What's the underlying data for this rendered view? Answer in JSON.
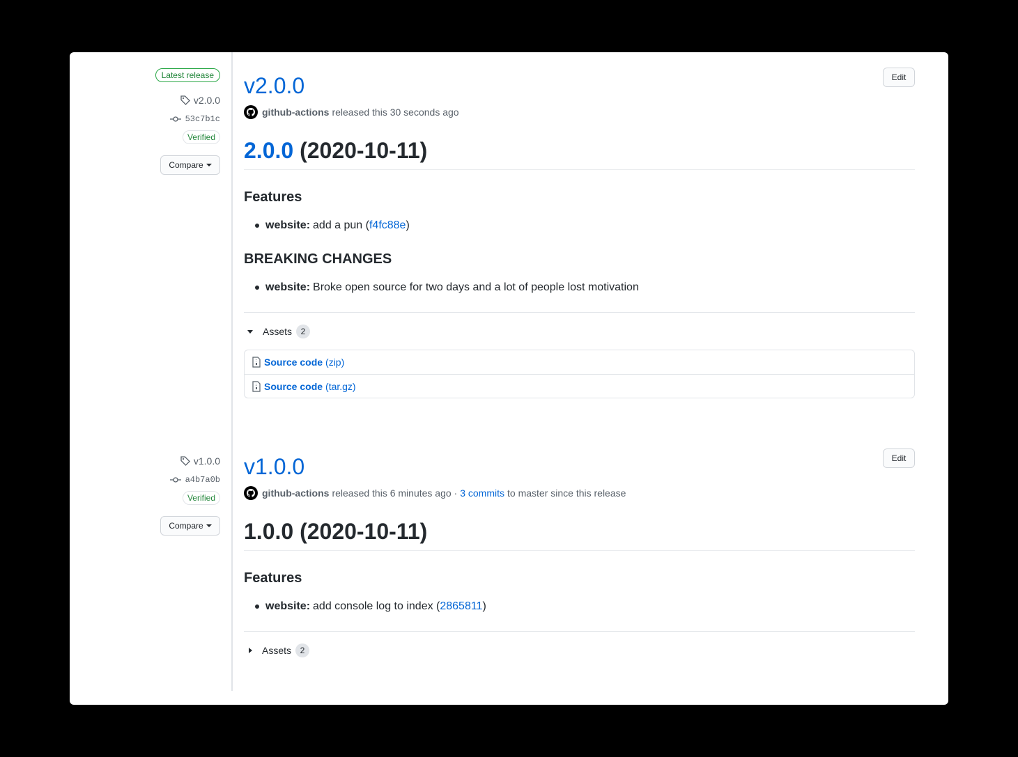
{
  "releases": [
    {
      "latest_label": "Latest release",
      "tag": "v2.0.0",
      "commit": "53c7b1c",
      "verified": "Verified",
      "compare": "Compare",
      "edit": "Edit",
      "title": "v2.0.0",
      "author": "github-actions",
      "released_text": "released this 30 seconds ago",
      "heading_version": "2.0.0",
      "heading_date": "(2020-10-11)",
      "features_heading": "Features",
      "feature": {
        "scope": "website:",
        "text": "add a pun (",
        "link": "f4fc88e",
        "close": ")"
      },
      "breaking_heading": "BREAKING CHANGES",
      "breaking": {
        "scope": "website:",
        "text": "Broke open source for two days and a lot of people lost motivation"
      },
      "assets_label": "Assets",
      "assets_count": "2",
      "assets_expanded": true,
      "asset_items": [
        {
          "name": "Source code",
          "ext": "(zip)"
        },
        {
          "name": "Source code",
          "ext": "(tar.gz)"
        }
      ]
    },
    {
      "tag": "v1.0.0",
      "commit": "a4b7a0b",
      "verified": "Verified",
      "compare": "Compare",
      "edit": "Edit",
      "title": "v1.0.0",
      "author": "github-actions",
      "released_text": "released this 6 minutes ago ·",
      "commits_link": "3 commits",
      "commits_suffix": "to master since this release",
      "heading": "1.0.0 (2020-10-11)",
      "features_heading": "Features",
      "feature": {
        "scope": "website:",
        "text": "add console log to index (",
        "link": "2865811",
        "close": ")"
      },
      "assets_label": "Assets",
      "assets_count": "2",
      "assets_expanded": false
    }
  ],
  "colors": {
    "link": "#0366d6",
    "green": "#22863a",
    "text": "#24292e",
    "muted": "#586069"
  },
  "icons": [
    "tag-icon",
    "commit-icon",
    "github-avatar-icon",
    "file-zip-icon",
    "caret-down-icon",
    "triangle-down-icon",
    "triangle-right-icon"
  ]
}
